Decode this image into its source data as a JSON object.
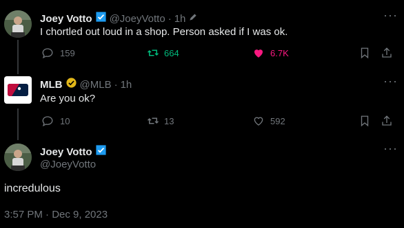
{
  "tweet1": {
    "author_name": "Joey Votto",
    "handle": "@JoeyVotto",
    "separator": "·",
    "time": "1h",
    "text": "I chortled out loud in a shop. Person asked if I was ok.",
    "replies": "159",
    "retweets": "664",
    "likes": "6.7K",
    "verified_badge": "blue-check-icon",
    "retweet_color": "#00ba7c",
    "like_color": "#f91880"
  },
  "tweet2": {
    "author_name": "MLB",
    "handle": "@MLB",
    "separator": "·",
    "time": "1h",
    "text": "Are you ok?",
    "replies": "10",
    "retweets": "13",
    "likes": "592",
    "verified_badge": "gold-check-icon"
  },
  "main": {
    "author_name": "Joey Votto",
    "handle": "@JoeyVotto",
    "text": "incredulous",
    "timestamp": "3:57 PM · Dec 9, 2023"
  },
  "more_glyph": "···"
}
